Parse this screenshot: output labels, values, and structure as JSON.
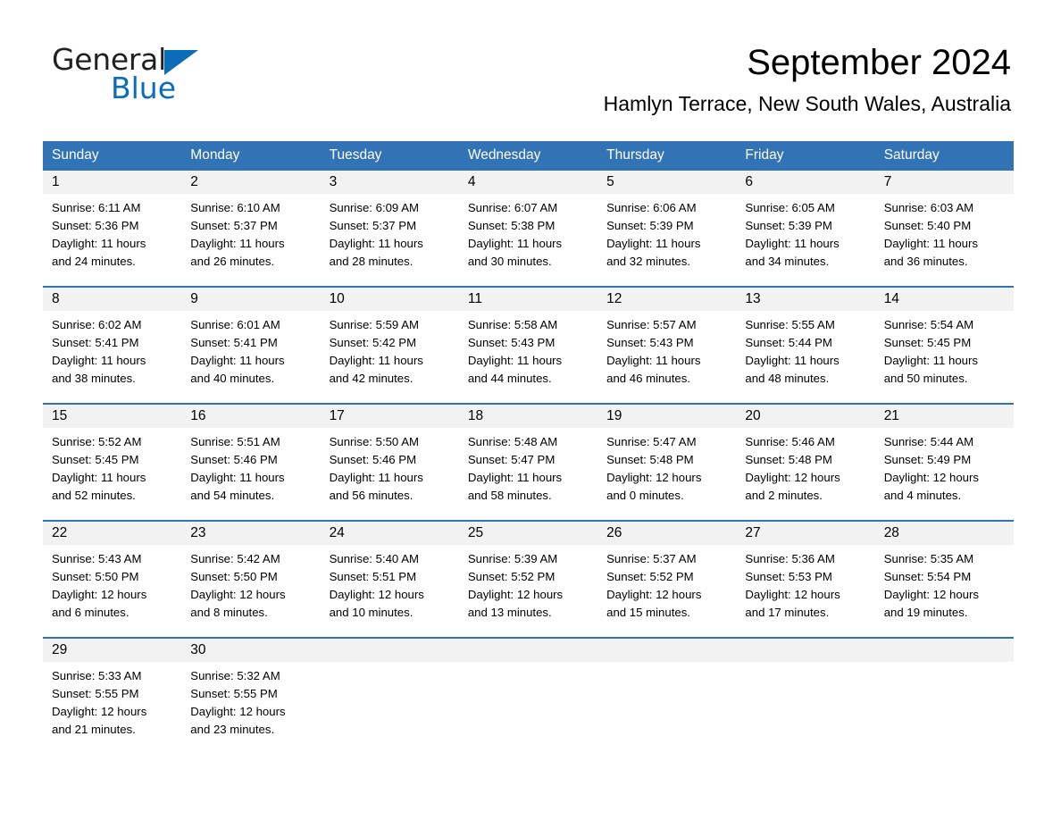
{
  "brand": {
    "name_part1": "General",
    "name_part2": "Blue",
    "accent_color": "#0b6cb7"
  },
  "header": {
    "month_title": "September 2024",
    "location": "Hamlyn Terrace, New South Wales, Australia",
    "header_bg_color": "#3173b5",
    "daynum_band_color": "#f2f2f2"
  },
  "weekday_headers": [
    "Sunday",
    "Monday",
    "Tuesday",
    "Wednesday",
    "Thursday",
    "Friday",
    "Saturday"
  ],
  "weeks": [
    [
      {
        "day": "1",
        "sunrise": "Sunrise: 6:11 AM",
        "sunset": "Sunset: 5:36 PM",
        "daylight_line1": "Daylight: 11 hours",
        "daylight_line2": "and 24 minutes."
      },
      {
        "day": "2",
        "sunrise": "Sunrise: 6:10 AM",
        "sunset": "Sunset: 5:37 PM",
        "daylight_line1": "Daylight: 11 hours",
        "daylight_line2": "and 26 minutes."
      },
      {
        "day": "3",
        "sunrise": "Sunrise: 6:09 AM",
        "sunset": "Sunset: 5:37 PM",
        "daylight_line1": "Daylight: 11 hours",
        "daylight_line2": "and 28 minutes."
      },
      {
        "day": "4",
        "sunrise": "Sunrise: 6:07 AM",
        "sunset": "Sunset: 5:38 PM",
        "daylight_line1": "Daylight: 11 hours",
        "daylight_line2": "and 30 minutes."
      },
      {
        "day": "5",
        "sunrise": "Sunrise: 6:06 AM",
        "sunset": "Sunset: 5:39 PM",
        "daylight_line1": "Daylight: 11 hours",
        "daylight_line2": "and 32 minutes."
      },
      {
        "day": "6",
        "sunrise": "Sunrise: 6:05 AM",
        "sunset": "Sunset: 5:39 PM",
        "daylight_line1": "Daylight: 11 hours",
        "daylight_line2": "and 34 minutes."
      },
      {
        "day": "7",
        "sunrise": "Sunrise: 6:03 AM",
        "sunset": "Sunset: 5:40 PM",
        "daylight_line1": "Daylight: 11 hours",
        "daylight_line2": "and 36 minutes."
      }
    ],
    [
      {
        "day": "8",
        "sunrise": "Sunrise: 6:02 AM",
        "sunset": "Sunset: 5:41 PM",
        "daylight_line1": "Daylight: 11 hours",
        "daylight_line2": "and 38 minutes."
      },
      {
        "day": "9",
        "sunrise": "Sunrise: 6:01 AM",
        "sunset": "Sunset: 5:41 PM",
        "daylight_line1": "Daylight: 11 hours",
        "daylight_line2": "and 40 minutes."
      },
      {
        "day": "10",
        "sunrise": "Sunrise: 5:59 AM",
        "sunset": "Sunset: 5:42 PM",
        "daylight_line1": "Daylight: 11 hours",
        "daylight_line2": "and 42 minutes."
      },
      {
        "day": "11",
        "sunrise": "Sunrise: 5:58 AM",
        "sunset": "Sunset: 5:43 PM",
        "daylight_line1": "Daylight: 11 hours",
        "daylight_line2": "and 44 minutes."
      },
      {
        "day": "12",
        "sunrise": "Sunrise: 5:57 AM",
        "sunset": "Sunset: 5:43 PM",
        "daylight_line1": "Daylight: 11 hours",
        "daylight_line2": "and 46 minutes."
      },
      {
        "day": "13",
        "sunrise": "Sunrise: 5:55 AM",
        "sunset": "Sunset: 5:44 PM",
        "daylight_line1": "Daylight: 11 hours",
        "daylight_line2": "and 48 minutes."
      },
      {
        "day": "14",
        "sunrise": "Sunrise: 5:54 AM",
        "sunset": "Sunset: 5:45 PM",
        "daylight_line1": "Daylight: 11 hours",
        "daylight_line2": "and 50 minutes."
      }
    ],
    [
      {
        "day": "15",
        "sunrise": "Sunrise: 5:52 AM",
        "sunset": "Sunset: 5:45 PM",
        "daylight_line1": "Daylight: 11 hours",
        "daylight_line2": "and 52 minutes."
      },
      {
        "day": "16",
        "sunrise": "Sunrise: 5:51 AM",
        "sunset": "Sunset: 5:46 PM",
        "daylight_line1": "Daylight: 11 hours",
        "daylight_line2": "and 54 minutes."
      },
      {
        "day": "17",
        "sunrise": "Sunrise: 5:50 AM",
        "sunset": "Sunset: 5:46 PM",
        "daylight_line1": "Daylight: 11 hours",
        "daylight_line2": "and 56 minutes."
      },
      {
        "day": "18",
        "sunrise": "Sunrise: 5:48 AM",
        "sunset": "Sunset: 5:47 PM",
        "daylight_line1": "Daylight: 11 hours",
        "daylight_line2": "and 58 minutes."
      },
      {
        "day": "19",
        "sunrise": "Sunrise: 5:47 AM",
        "sunset": "Sunset: 5:48 PM",
        "daylight_line1": "Daylight: 12 hours",
        "daylight_line2": "and 0 minutes."
      },
      {
        "day": "20",
        "sunrise": "Sunrise: 5:46 AM",
        "sunset": "Sunset: 5:48 PM",
        "daylight_line1": "Daylight: 12 hours",
        "daylight_line2": "and 2 minutes."
      },
      {
        "day": "21",
        "sunrise": "Sunrise: 5:44 AM",
        "sunset": "Sunset: 5:49 PM",
        "daylight_line1": "Daylight: 12 hours",
        "daylight_line2": "and 4 minutes."
      }
    ],
    [
      {
        "day": "22",
        "sunrise": "Sunrise: 5:43 AM",
        "sunset": "Sunset: 5:50 PM",
        "daylight_line1": "Daylight: 12 hours",
        "daylight_line2": "and 6 minutes."
      },
      {
        "day": "23",
        "sunrise": "Sunrise: 5:42 AM",
        "sunset": "Sunset: 5:50 PM",
        "daylight_line1": "Daylight: 12 hours",
        "daylight_line2": "and 8 minutes."
      },
      {
        "day": "24",
        "sunrise": "Sunrise: 5:40 AM",
        "sunset": "Sunset: 5:51 PM",
        "daylight_line1": "Daylight: 12 hours",
        "daylight_line2": "and 10 minutes."
      },
      {
        "day": "25",
        "sunrise": "Sunrise: 5:39 AM",
        "sunset": "Sunset: 5:52 PM",
        "daylight_line1": "Daylight: 12 hours",
        "daylight_line2": "and 13 minutes."
      },
      {
        "day": "26",
        "sunrise": "Sunrise: 5:37 AM",
        "sunset": "Sunset: 5:52 PM",
        "daylight_line1": "Daylight: 12 hours",
        "daylight_line2": "and 15 minutes."
      },
      {
        "day": "27",
        "sunrise": "Sunrise: 5:36 AM",
        "sunset": "Sunset: 5:53 PM",
        "daylight_line1": "Daylight: 12 hours",
        "daylight_line2": "and 17 minutes."
      },
      {
        "day": "28",
        "sunrise": "Sunrise: 5:35 AM",
        "sunset": "Sunset: 5:54 PM",
        "daylight_line1": "Daylight: 12 hours",
        "daylight_line2": "and 19 minutes."
      }
    ],
    [
      {
        "day": "29",
        "sunrise": "Sunrise: 5:33 AM",
        "sunset": "Sunset: 5:55 PM",
        "daylight_line1": "Daylight: 12 hours",
        "daylight_line2": "and 21 minutes."
      },
      {
        "day": "30",
        "sunrise": "Sunrise: 5:32 AM",
        "sunset": "Sunset: 5:55 PM",
        "daylight_line1": "Daylight: 12 hours",
        "daylight_line2": "and 23 minutes."
      },
      {
        "day": "",
        "sunrise": "",
        "sunset": "",
        "daylight_line1": "",
        "daylight_line2": ""
      },
      {
        "day": "",
        "sunrise": "",
        "sunset": "",
        "daylight_line1": "",
        "daylight_line2": ""
      },
      {
        "day": "",
        "sunrise": "",
        "sunset": "",
        "daylight_line1": "",
        "daylight_line2": ""
      },
      {
        "day": "",
        "sunrise": "",
        "sunset": "",
        "daylight_line1": "",
        "daylight_line2": ""
      },
      {
        "day": "",
        "sunrise": "",
        "sunset": "",
        "daylight_line1": "",
        "daylight_line2": ""
      }
    ]
  ]
}
